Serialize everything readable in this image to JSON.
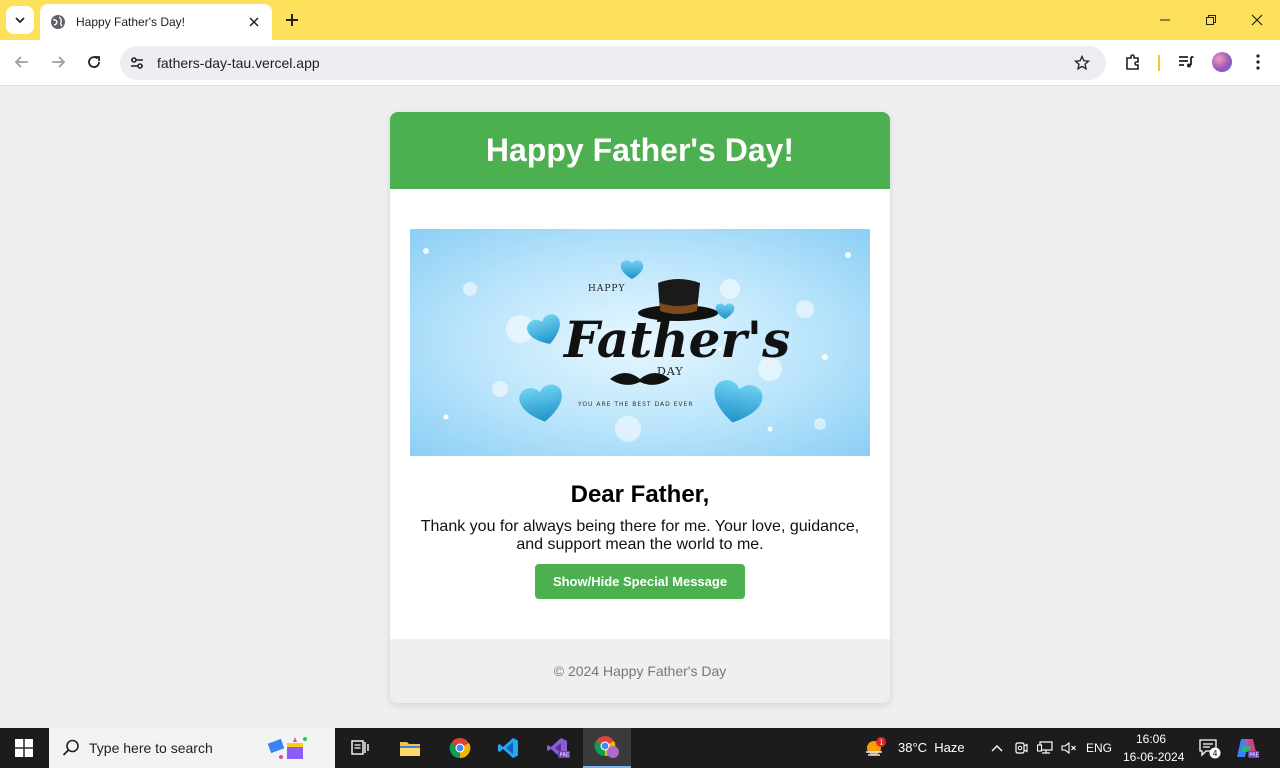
{
  "browser": {
    "tab_title": "Happy Father's Day!",
    "url": "fathers-day-tau.vercel.app"
  },
  "page": {
    "header_title": "Happy Father's Day!",
    "hero_image": {
      "line_happy": "HAPPY",
      "line_fathers": "Father's",
      "line_day": "DAY",
      "tagline": "YOU ARE THE BEST DAD EVER"
    },
    "greeting": "Dear Father,",
    "message": "Thank you for always being there for me. Your love, guidance, and support mean the world to me.",
    "button_label": "Show/Hide Special Message",
    "footer": "© 2024 Happy Father's Day"
  },
  "taskbar": {
    "search_placeholder": "Type here to search",
    "weather": "38°C  Haze",
    "weather_badge": "1",
    "language": "ENG",
    "time": "16:06",
    "date": "16-06-2024",
    "notification_count": "4"
  },
  "colors": {
    "tabbar": "#fde05a",
    "accent_green": "#4caf50",
    "page_bg": "#efefef"
  }
}
